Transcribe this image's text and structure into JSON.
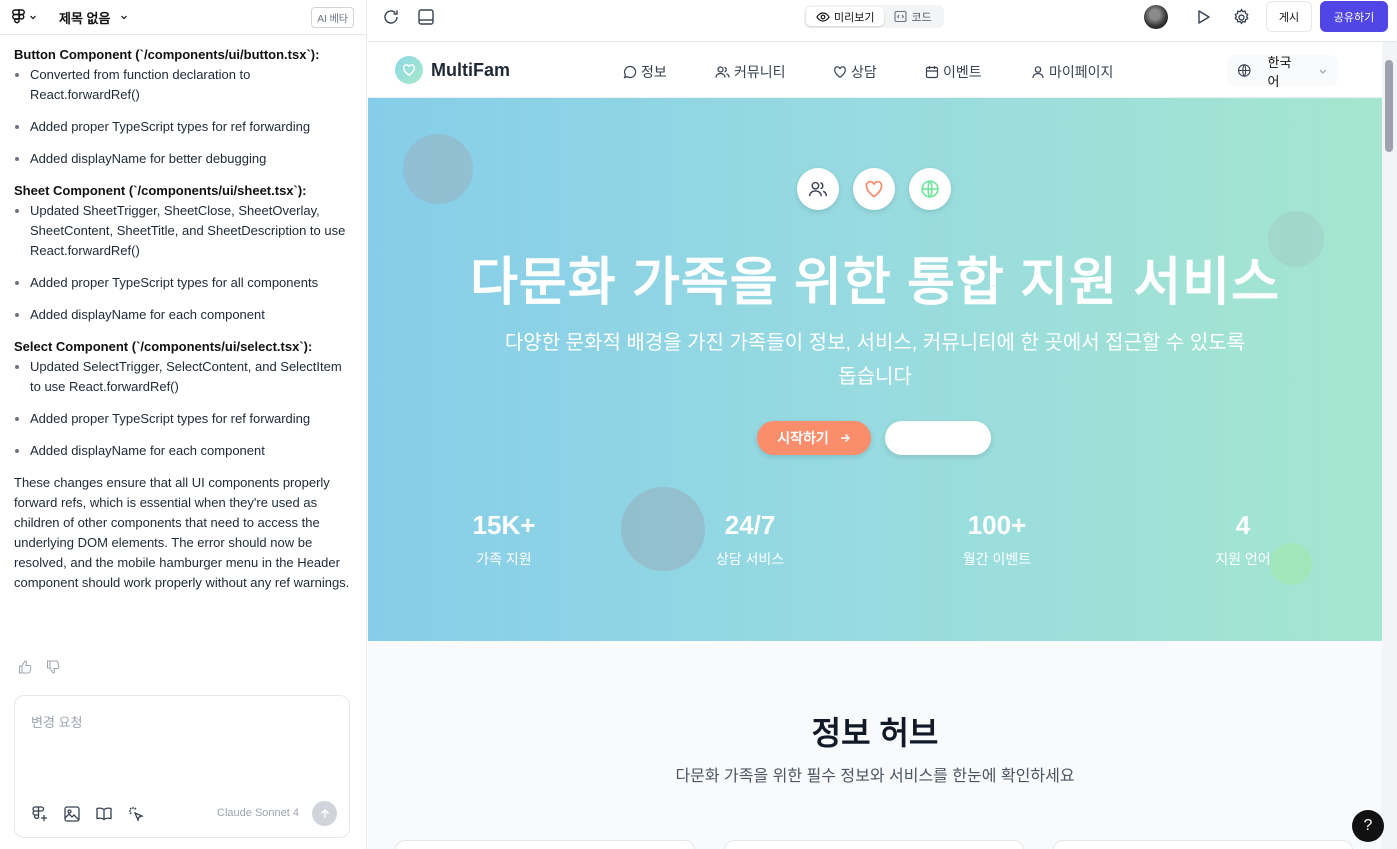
{
  "editor": {
    "project_title": "제목 없음",
    "ai_badge": "AI 베타"
  },
  "chat": {
    "sections": [
      {
        "heading": "Button Component (`/components/ui/button.tsx`):",
        "items": [
          "Converted from function declaration to React.forwardRef()",
          "Added proper TypeScript types for ref forwarding",
          "Added displayName for better debugging"
        ]
      },
      {
        "heading": "Sheet Component (`/components/ui/sheet.tsx`):",
        "items": [
          "Updated SheetTrigger, SheetClose, SheetOverlay, SheetContent, SheetTitle, and SheetDescription to use React.forwardRef()",
          "Added proper TypeScript types for all components",
          "Added displayName for each component"
        ]
      },
      {
        "heading": "Select Component (`/components/ui/select.tsx`):",
        "items": [
          "Updated SelectTrigger, SelectContent, and SelectItem to use React.forwardRef()",
          "Added proper TypeScript types for ref forwarding",
          "Added displayName for each component"
        ]
      }
    ],
    "summary": "These changes ensure that all UI components properly forward refs, which is essential when they're used as children of other components that need to access the underlying DOM elements. The error should now be resolved, and the mobile hamburger menu in the Header component should work properly without any ref warnings.",
    "input_placeholder": "변경 요청",
    "model": "Claude Sonnet 4"
  },
  "toolbar": {
    "preview_tab": "미리보기",
    "code_tab": "코드",
    "post_label": "게시",
    "share_label": "공유하기"
  },
  "site": {
    "brand": "MultiFam",
    "nav": [
      "정보",
      "커뮤니티",
      "상담",
      "이벤트",
      "마이페이지"
    ],
    "language": "한국어",
    "hero": {
      "title": "다문화 가족을 위한 통합 지원 서비스",
      "subtitle_line1": "다양한 문화적 배경을 가진 가족들이 정보, 서비스, 커뮤니티에 한 곳에서 접근할 수 있도록",
      "subtitle_line2": "돕습니다",
      "start_button": "시작하기",
      "stats": [
        {
          "value": "15K+",
          "label": "가족 지원"
        },
        {
          "value": "24/7",
          "label": "상담 서비스"
        },
        {
          "value": "100+",
          "label": "월간 이벤트"
        },
        {
          "value": "4",
          "label": "지원 언어"
        }
      ]
    },
    "section": {
      "title": "정보 허브",
      "subtitle": "다문화 가족을 위한 필수 정보와 서비스를 한눈에 확인하세요"
    }
  },
  "help_label": "?"
}
